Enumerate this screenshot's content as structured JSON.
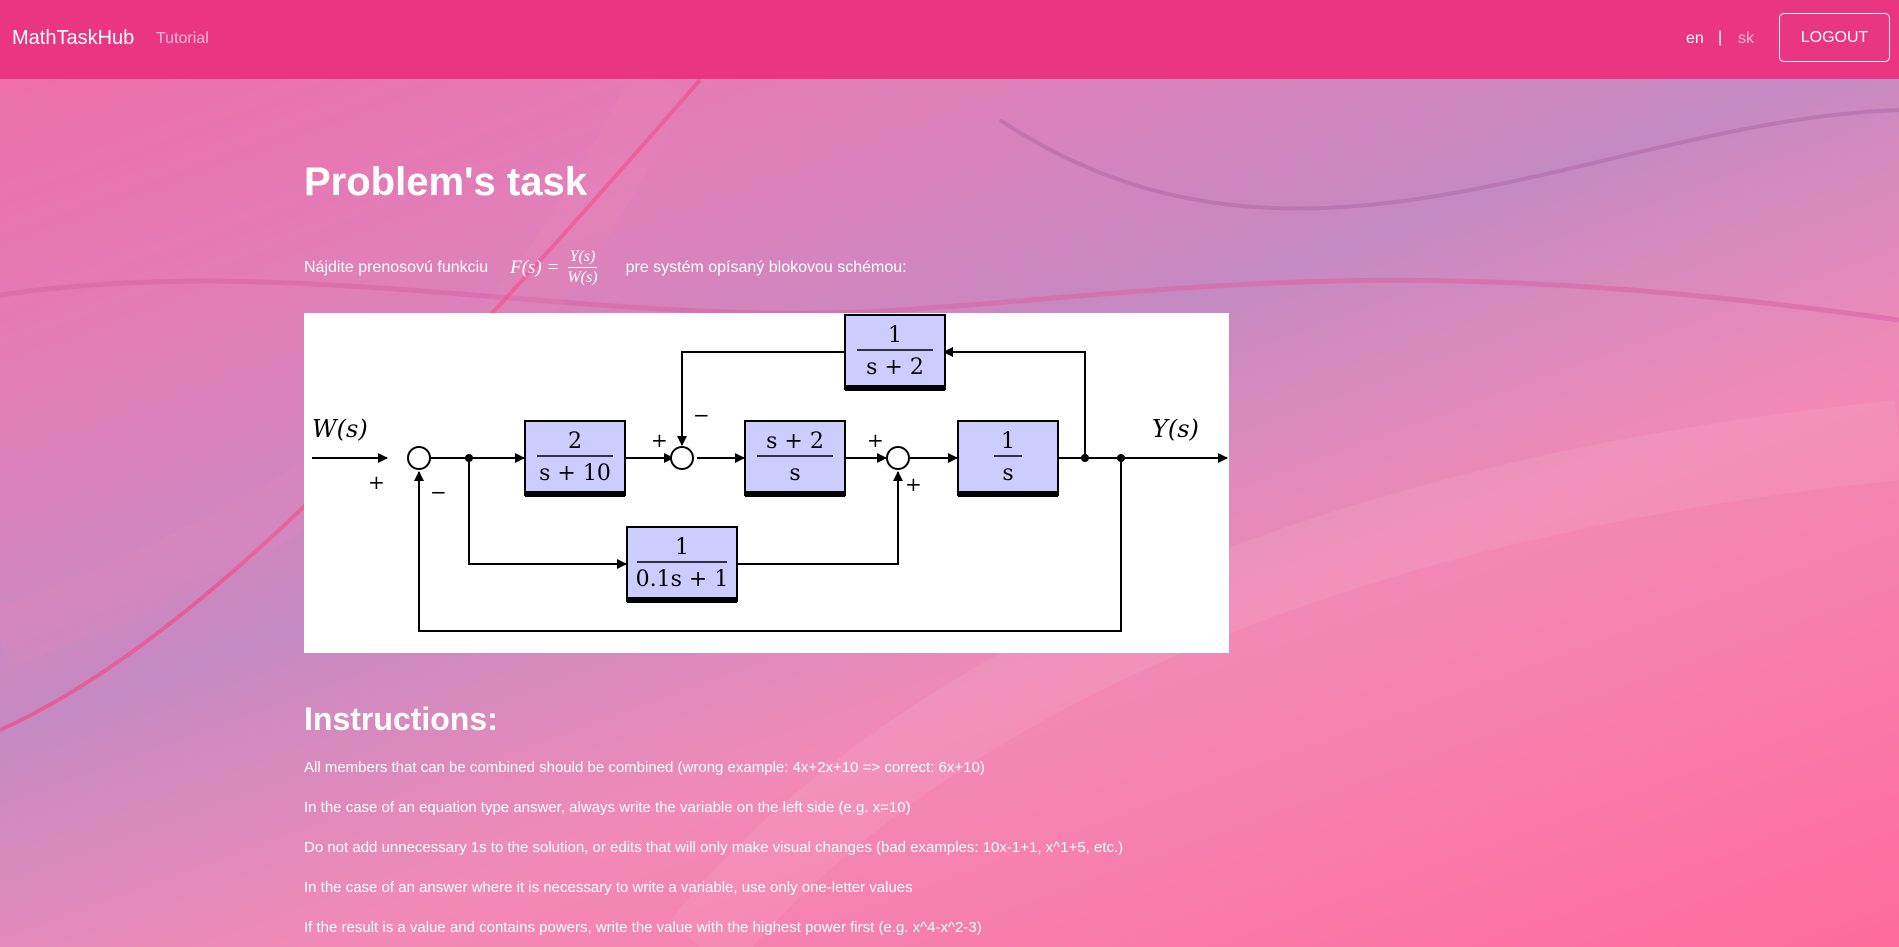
{
  "navbar": {
    "brand": "MathTaskHub",
    "tutorial_label": "Tutorial",
    "lang_en": "en",
    "lang_separator": "|",
    "lang_sk": "sk",
    "logout_label": "LOGOUT"
  },
  "main": {
    "title": "Problem's task",
    "task_prefix": "Nájdite prenosovú funkciu",
    "formula_lhs": "F(s) =",
    "formula_num": "Y(s)",
    "formula_den": "W(s)",
    "task_suffix": "pre systém opísaný blokovou schémou:",
    "diagram": {
      "input_label": "W(s)",
      "output_label": "Y(s)",
      "block_feedback": {
        "num": "1",
        "den": "s + 2"
      },
      "block_1": {
        "num": "2",
        "den": "s + 10"
      },
      "block_2": {
        "num": "s + 2",
        "den": "s"
      },
      "block_3": {
        "num": "1",
        "den": "s"
      },
      "block_ff": {
        "num": "1",
        "den": "0.1s + 1"
      },
      "sum1_in": "+",
      "sum1_fb": "−",
      "sum2_in": "+",
      "sum2_fb": "−",
      "sum3_in": "+",
      "sum3_ff": "+"
    },
    "instructions_title": "Instructions:",
    "instructions": [
      "All members that can be combined should be combined (wrong example: 4x+2x+10 => correct: 6x+10)",
      "In the case of an equation type answer, always write the variable on the left side (e.g. x=10)",
      "Do not add unnecessary 1s to the solution, or edits that will only make visual changes (bad examples: 10x-1+1, x^1+5, etc.)",
      "In the case of an answer where it is necessary to write a variable, use only one-letter values",
      "If the result is a value and contains powers, write the value with the highest power first (e.g. x^4-x^2-3)"
    ]
  },
  "colors": {
    "navbar": "#ea3582",
    "block_fill": "#ccccff",
    "text": "#ffffff"
  }
}
